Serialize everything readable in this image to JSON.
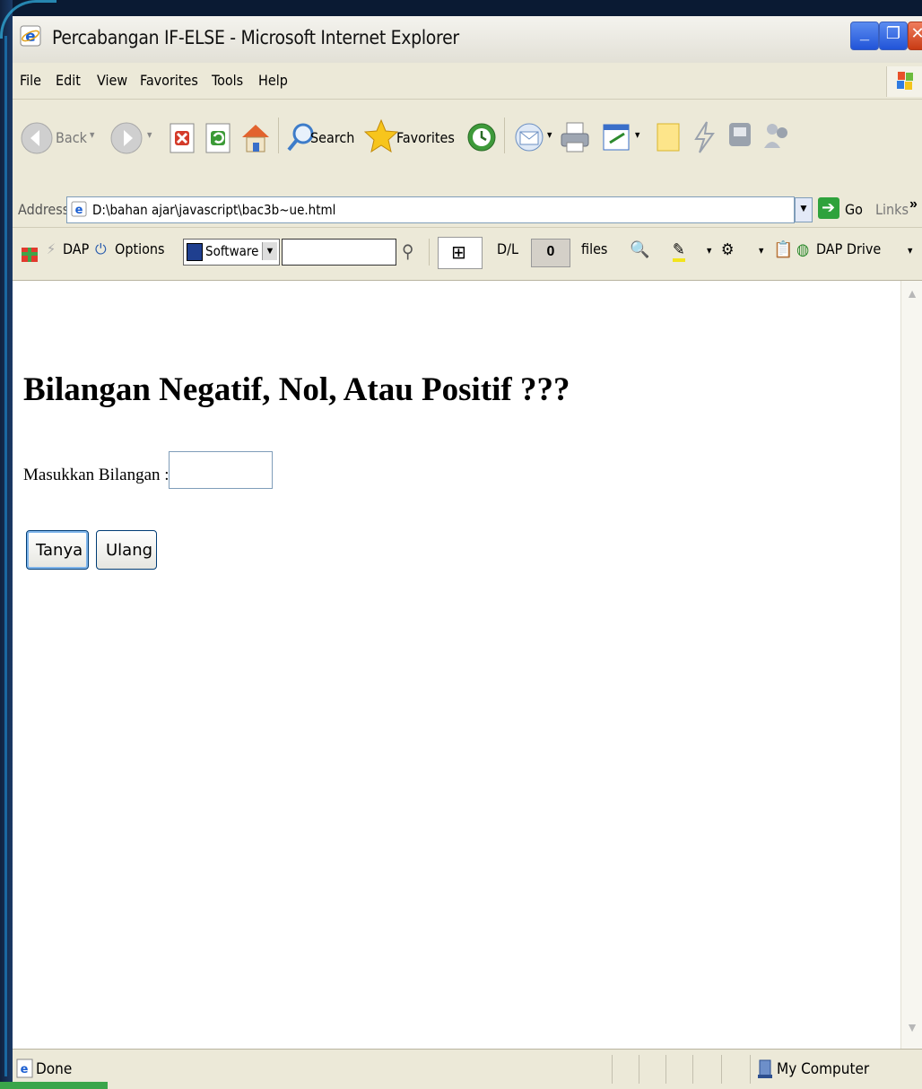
{
  "window": {
    "title": "Percabangan IF-ELSE - Microsoft Internet Explorer",
    "buttons": [
      "minimize",
      "maximize",
      "close"
    ]
  },
  "menu": [
    "File",
    "Edit",
    "View",
    "Favorites",
    "Tools",
    "Help"
  ],
  "toolbar": {
    "back": "Back",
    "search": "Search",
    "favorites": "Favorites"
  },
  "address": {
    "label": "Address",
    "value": "D:\\bahan ajar\\javascript\\bac3b~ue.html",
    "go": "Go",
    "links": "Links"
  },
  "dap": {
    "dap": "DAP",
    "options": "Options",
    "category": "Software",
    "dl_label": "D/L",
    "dl_count": "0",
    "files": "files",
    "drive": "DAP Drive"
  },
  "page": {
    "heading": "Bilangan Negatif, Nol, Atau Positif ???",
    "input_label": "Masukkan Bilangan :",
    "input_value": "",
    "ask_button": "Tanya",
    "reset_button": "Ulang"
  },
  "status": {
    "text": "Done",
    "zone": "My Computer"
  },
  "colors": {
    "frame": "#0a1a33",
    "accent": "#1e90d6",
    "chrome": "#ece9d8"
  }
}
